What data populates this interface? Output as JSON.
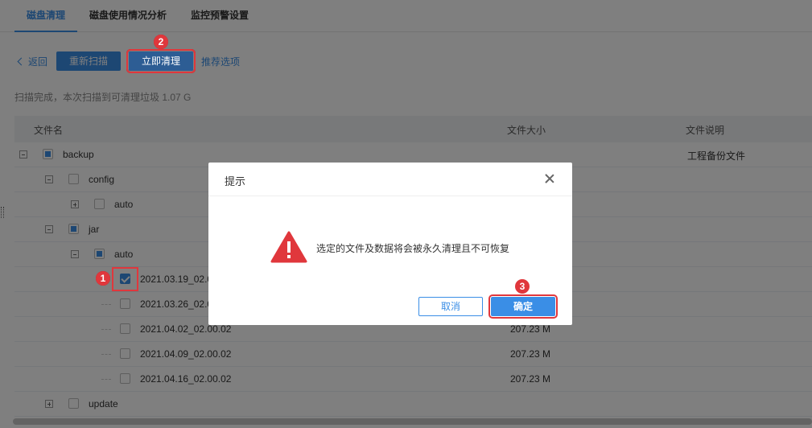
{
  "tabs": [
    {
      "label": "磁盘清理"
    },
    {
      "label": "磁盘使用情况分析"
    },
    {
      "label": "监控预警设置"
    }
  ],
  "toolbar": {
    "back_label": "返回",
    "rescan_label": "重新扫描",
    "clean_label": "立即清理",
    "recommend_label": "推荐选项"
  },
  "scan_status": "扫描完成，本次扫描到可清理垃圾 1.07 G",
  "table": {
    "headers": {
      "name": "文件名",
      "size": "文件大小",
      "desc": "文件说明"
    },
    "rows": [
      {
        "name": "backup",
        "size": "",
        "desc": "工程备份文件"
      },
      {
        "name": "config",
        "size": "",
        "desc": ""
      },
      {
        "name": "auto",
        "size": "",
        "desc": ""
      },
      {
        "name": "jar",
        "size": "",
        "desc": ""
      },
      {
        "name": "auto",
        "size": "",
        "desc": ""
      },
      {
        "name": "2021.03.19_02.0",
        "size": "",
        "desc": ""
      },
      {
        "name": "2021.03.26_02.0",
        "size": "",
        "desc": ""
      },
      {
        "name": "2021.04.02_02.00.02",
        "size": "207.23 M",
        "desc": ""
      },
      {
        "name": "2021.04.09_02.00.02",
        "size": "207.23 M",
        "desc": ""
      },
      {
        "name": "2021.04.16_02.00.02",
        "size": "207.23 M",
        "desc": ""
      },
      {
        "name": "update",
        "size": "",
        "desc": ""
      }
    ]
  },
  "dialog": {
    "title": "提示",
    "message": "选定的文件及数据将会被永久清理且不可恢复",
    "cancel_label": "取消",
    "ok_label": "确定"
  },
  "badges": {
    "b1": "1",
    "b2": "2",
    "b3": "3"
  },
  "colors": {
    "accent": "#3a8ee6",
    "highlight": "#e0373c",
    "warning": "#e0373c"
  }
}
